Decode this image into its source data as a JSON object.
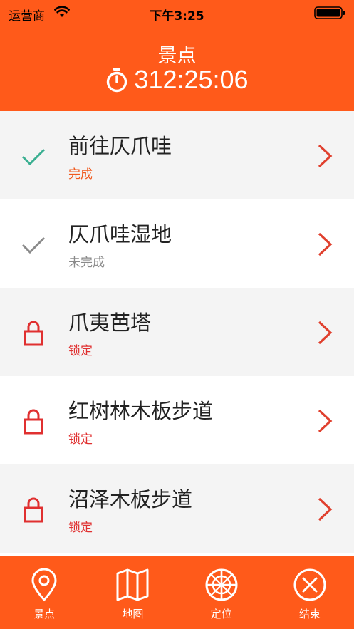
{
  "status_bar": {
    "carrier": "运营商",
    "time": "下午3:25"
  },
  "header": {
    "title": "景点",
    "timer": "312:25:06"
  },
  "colors": {
    "brand_orange": "#ff5a1a",
    "done_teal": "#3aaf91",
    "done_text": "#f05a1e",
    "incomplete_gray": "#8a8a8a",
    "locked_red": "#e03030"
  },
  "spots": [
    {
      "name": "前往仄爪哇",
      "state": "完成",
      "status": "done",
      "icon": "check-icon"
    },
    {
      "name": "仄爪哇湿地",
      "state": "未完成",
      "status": "incomplete",
      "icon": "check-icon"
    },
    {
      "name": "爪夷芭塔",
      "state": "锁定",
      "status": "locked",
      "icon": "lock-icon"
    },
    {
      "name": "红树林木板步道",
      "state": "锁定",
      "status": "locked",
      "icon": "lock-icon"
    },
    {
      "name": "沼泽木板步道",
      "state": "锁定",
      "status": "locked",
      "icon": "lock-icon"
    }
  ],
  "tabbar": {
    "tabs": [
      {
        "label": "景点",
        "icon": "map-pin-icon"
      },
      {
        "label": "地图",
        "icon": "folded-map-icon"
      },
      {
        "label": "定位",
        "icon": "locate-target-icon"
      },
      {
        "label": "结束",
        "icon": "close-circle-icon"
      }
    ]
  }
}
